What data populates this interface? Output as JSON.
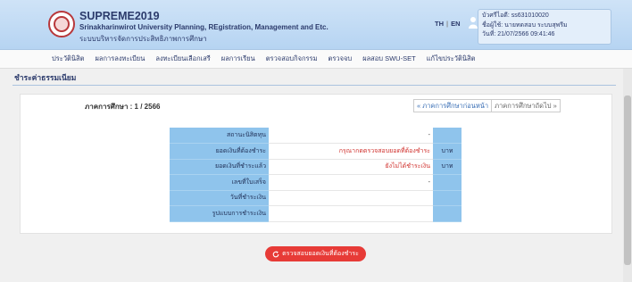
{
  "header": {
    "app_name": "SUPREME2019",
    "subtitle": "Srinakharinwirot University Planning, REgistration, Management and Etc.",
    "thai_subtitle": "ระบบบริหารจัดการประสิทธิภาพการศึกษา",
    "lang_th": "TH",
    "lang_sep": "|",
    "lang_en": "EN"
  },
  "user": {
    "id_line": "บัวศรีไอดี: ss631010020",
    "name_line": "ชื่อผู้ใช้: นายทดสอบ ระบบสุพรีม",
    "date_line": "วันที่: 21/07/2566  09:41:46"
  },
  "nav": {
    "items": [
      "ประวัตินิสิต",
      "ผลการลงทะเบียน",
      "ลงทะเบียนเลือกเสรี",
      "ผลการเรียน",
      "ตรวจสอบกิจกรรม",
      "ตรวจจบ",
      "ผลสอบ SWU-SET",
      "แก้ไขประวัตินิสิต"
    ]
  },
  "page": {
    "section_title": "ชำระค่าธรรมเนียม",
    "term_label": "ภาคการศึกษา : 1 / 2566",
    "prev_term": "« ภาคการศึกษาก่อนหน้า",
    "next_term": "ภาคการศึกษาถัดไป »"
  },
  "fee_table": {
    "rows": [
      {
        "label": "สถานะนิสิตทุน",
        "value": "-",
        "unit": ""
      },
      {
        "label": "ยอดเงินที่ต้องชำระ",
        "value": "กรุณากดตรวจสอบยอดที่ต้องชำระ",
        "unit": "บาท"
      },
      {
        "label": "ยอดเงินที่ชำระแล้ว",
        "value": "ยังไม่ได้ชำระเงิน",
        "unit": "บาท"
      },
      {
        "label": "เลขที่ใบเสร็จ",
        "value": "-",
        "unit": ""
      },
      {
        "label": "วันที่ชำระเงิน",
        "value": "",
        "unit": ""
      },
      {
        "label": "รูปแบบการชำระเงิน",
        "value": "",
        "unit": ""
      }
    ]
  },
  "actions": {
    "check_button": "ตรวจสอบยอดเงินที่ต้องชำระ"
  },
  "colors": {
    "header_bg": "#b6d4f2",
    "table_label_bg": "#8fc4ec",
    "button_red": "#e73b37",
    "alert_red": "#d0312d"
  }
}
